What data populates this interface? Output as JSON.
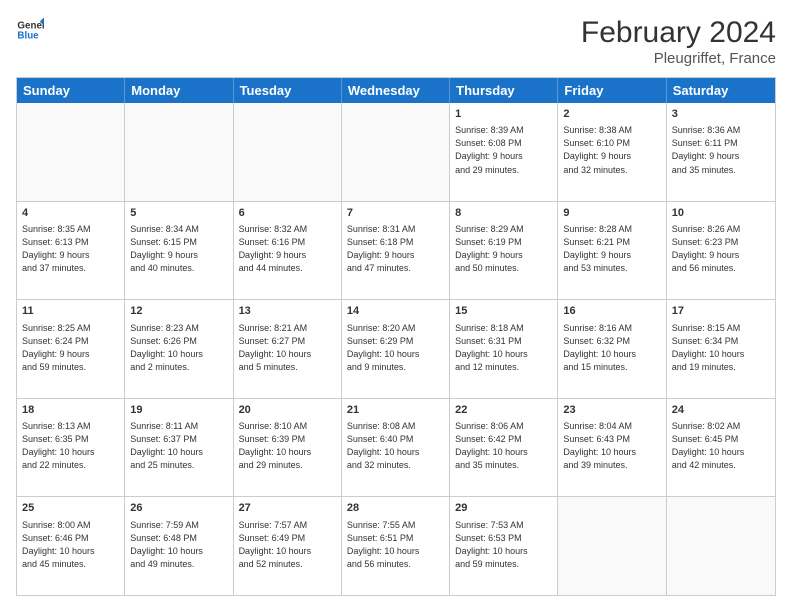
{
  "header": {
    "logo_line1": "General",
    "logo_line2": "Blue",
    "title": "February 2024",
    "location": "Pleugriffet, France"
  },
  "days_of_week": [
    "Sunday",
    "Monday",
    "Tuesday",
    "Wednesday",
    "Thursday",
    "Friday",
    "Saturday"
  ],
  "rows": [
    [
      {
        "day": "",
        "info": ""
      },
      {
        "day": "",
        "info": ""
      },
      {
        "day": "",
        "info": ""
      },
      {
        "day": "",
        "info": ""
      },
      {
        "day": "1",
        "info": "Sunrise: 8:39 AM\nSunset: 6:08 PM\nDaylight: 9 hours\nand 29 minutes."
      },
      {
        "day": "2",
        "info": "Sunrise: 8:38 AM\nSunset: 6:10 PM\nDaylight: 9 hours\nand 32 minutes."
      },
      {
        "day": "3",
        "info": "Sunrise: 8:36 AM\nSunset: 6:11 PM\nDaylight: 9 hours\nand 35 minutes."
      }
    ],
    [
      {
        "day": "4",
        "info": "Sunrise: 8:35 AM\nSunset: 6:13 PM\nDaylight: 9 hours\nand 37 minutes."
      },
      {
        "day": "5",
        "info": "Sunrise: 8:34 AM\nSunset: 6:15 PM\nDaylight: 9 hours\nand 40 minutes."
      },
      {
        "day": "6",
        "info": "Sunrise: 8:32 AM\nSunset: 6:16 PM\nDaylight: 9 hours\nand 44 minutes."
      },
      {
        "day": "7",
        "info": "Sunrise: 8:31 AM\nSunset: 6:18 PM\nDaylight: 9 hours\nand 47 minutes."
      },
      {
        "day": "8",
        "info": "Sunrise: 8:29 AM\nSunset: 6:19 PM\nDaylight: 9 hours\nand 50 minutes."
      },
      {
        "day": "9",
        "info": "Sunrise: 8:28 AM\nSunset: 6:21 PM\nDaylight: 9 hours\nand 53 minutes."
      },
      {
        "day": "10",
        "info": "Sunrise: 8:26 AM\nSunset: 6:23 PM\nDaylight: 9 hours\nand 56 minutes."
      }
    ],
    [
      {
        "day": "11",
        "info": "Sunrise: 8:25 AM\nSunset: 6:24 PM\nDaylight: 9 hours\nand 59 minutes."
      },
      {
        "day": "12",
        "info": "Sunrise: 8:23 AM\nSunset: 6:26 PM\nDaylight: 10 hours\nand 2 minutes."
      },
      {
        "day": "13",
        "info": "Sunrise: 8:21 AM\nSunset: 6:27 PM\nDaylight: 10 hours\nand 5 minutes."
      },
      {
        "day": "14",
        "info": "Sunrise: 8:20 AM\nSunset: 6:29 PM\nDaylight: 10 hours\nand 9 minutes."
      },
      {
        "day": "15",
        "info": "Sunrise: 8:18 AM\nSunset: 6:31 PM\nDaylight: 10 hours\nand 12 minutes."
      },
      {
        "day": "16",
        "info": "Sunrise: 8:16 AM\nSunset: 6:32 PM\nDaylight: 10 hours\nand 15 minutes."
      },
      {
        "day": "17",
        "info": "Sunrise: 8:15 AM\nSunset: 6:34 PM\nDaylight: 10 hours\nand 19 minutes."
      }
    ],
    [
      {
        "day": "18",
        "info": "Sunrise: 8:13 AM\nSunset: 6:35 PM\nDaylight: 10 hours\nand 22 minutes."
      },
      {
        "day": "19",
        "info": "Sunrise: 8:11 AM\nSunset: 6:37 PM\nDaylight: 10 hours\nand 25 minutes."
      },
      {
        "day": "20",
        "info": "Sunrise: 8:10 AM\nSunset: 6:39 PM\nDaylight: 10 hours\nand 29 minutes."
      },
      {
        "day": "21",
        "info": "Sunrise: 8:08 AM\nSunset: 6:40 PM\nDaylight: 10 hours\nand 32 minutes."
      },
      {
        "day": "22",
        "info": "Sunrise: 8:06 AM\nSunset: 6:42 PM\nDaylight: 10 hours\nand 35 minutes."
      },
      {
        "day": "23",
        "info": "Sunrise: 8:04 AM\nSunset: 6:43 PM\nDaylight: 10 hours\nand 39 minutes."
      },
      {
        "day": "24",
        "info": "Sunrise: 8:02 AM\nSunset: 6:45 PM\nDaylight: 10 hours\nand 42 minutes."
      }
    ],
    [
      {
        "day": "25",
        "info": "Sunrise: 8:00 AM\nSunset: 6:46 PM\nDaylight: 10 hours\nand 45 minutes."
      },
      {
        "day": "26",
        "info": "Sunrise: 7:59 AM\nSunset: 6:48 PM\nDaylight: 10 hours\nand 49 minutes."
      },
      {
        "day": "27",
        "info": "Sunrise: 7:57 AM\nSunset: 6:49 PM\nDaylight: 10 hours\nand 52 minutes."
      },
      {
        "day": "28",
        "info": "Sunrise: 7:55 AM\nSunset: 6:51 PM\nDaylight: 10 hours\nand 56 minutes."
      },
      {
        "day": "29",
        "info": "Sunrise: 7:53 AM\nSunset: 6:53 PM\nDaylight: 10 hours\nand 59 minutes."
      },
      {
        "day": "",
        "info": ""
      },
      {
        "day": "",
        "info": ""
      }
    ]
  ]
}
